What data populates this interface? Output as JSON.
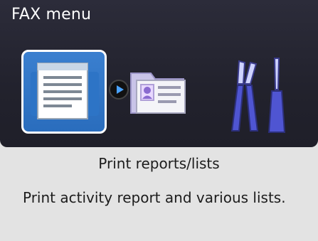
{
  "header": {
    "title": "FAX menu"
  },
  "menu": {
    "items": [
      {
        "icon": "print-report-icon",
        "selected": true
      },
      {
        "icon": "address-book-folder-icon",
        "selected": false
      },
      {
        "icon": "maintenance-tools-icon",
        "selected": false
      }
    ]
  },
  "selection": {
    "title": "Print reports/lists",
    "description": "Print activity report and various lists."
  },
  "colors": {
    "panel_dark": "#22222d",
    "panel_light": "#e3e3e3",
    "accent_blue": "#2a6dbd",
    "arrow_blue": "#4aa3ff"
  }
}
